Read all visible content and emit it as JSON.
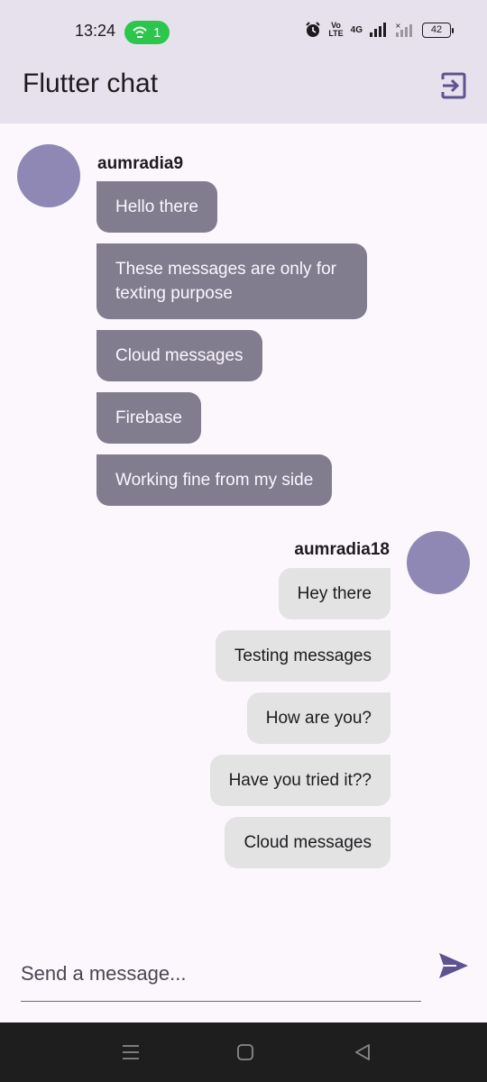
{
  "status_bar": {
    "time": "13:24",
    "hotspot_count": "1",
    "volte": "Vo\nLTE",
    "network": "4G",
    "battery": "42"
  },
  "app_bar": {
    "title": "Flutter chat",
    "logout_icon": "logout-icon"
  },
  "chat": {
    "groups": [
      {
        "sender": "aumradia9",
        "side": "left",
        "messages": [
          "Hello there",
          "These messages are only for texting purpose",
          "Cloud messages",
          "Firebase",
          "Working fine from my side"
        ]
      },
      {
        "sender": "aumradia18",
        "side": "right",
        "messages": [
          "Hey there",
          "Testing messages",
          "How are you?",
          "Have you tried it??",
          "Cloud messages"
        ]
      }
    ]
  },
  "input": {
    "placeholder": "Send a message...",
    "value": "",
    "send_icon": "send-icon"
  },
  "nav": {
    "recents_icon": "menu-icon",
    "home_icon": "home-icon",
    "back_icon": "back-icon"
  },
  "colors": {
    "app_bar_bg": "#e6e1ec",
    "background": "#fcf7fc",
    "avatar": "#8f88b4",
    "left_bubble": "#827d8e",
    "right_bubble": "#e3e3e3",
    "accent": "#5d5391"
  }
}
